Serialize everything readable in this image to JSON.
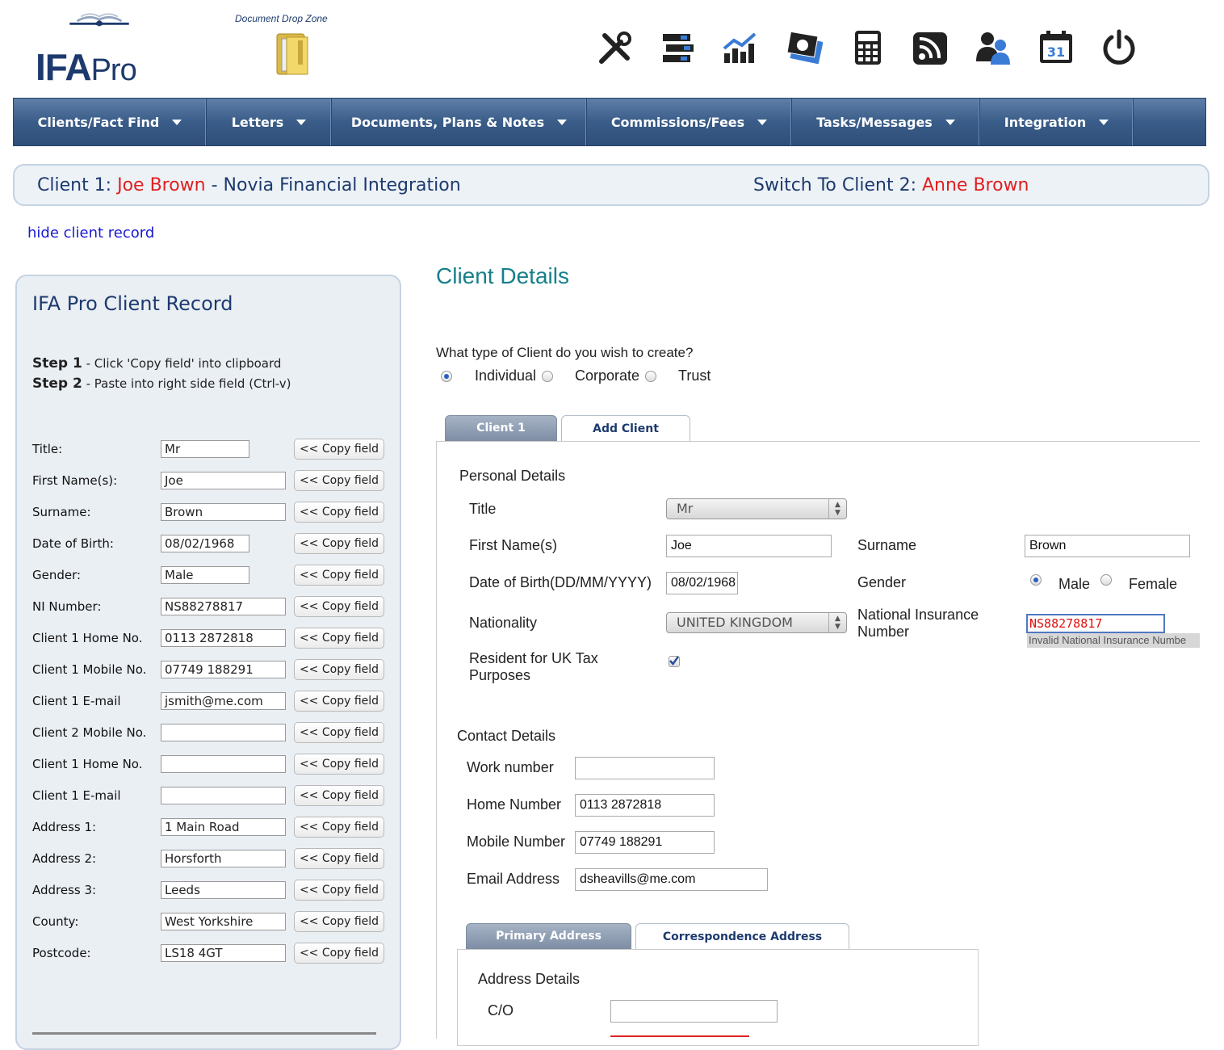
{
  "header": {
    "logo": "IFA Pro",
    "drop_zone_label": "Document Drop Zone",
    "toolbar_icons": [
      "tools-icon",
      "servers-icon",
      "growth-chart-icon",
      "money-icon",
      "calculator-icon",
      "rss-icon",
      "users-icon",
      "calendar-icon",
      "power-icon"
    ],
    "calendar_day": "31"
  },
  "nav": {
    "items": [
      {
        "label": "Clients/Fact Find"
      },
      {
        "label": "Letters"
      },
      {
        "label": "Documents, Plans & Notes"
      },
      {
        "label": "Commissions/Fees"
      },
      {
        "label": "Tasks/Messages"
      },
      {
        "label": "Integration"
      }
    ]
  },
  "client_bar": {
    "client1_prefix": "Client 1:",
    "client1_name": "Joe Brown",
    "client1_suffix": "- Novia Financial Integration",
    "switch_prefix": "Switch To Client 2:",
    "client2_name": "Anne Brown"
  },
  "hide_link": "hide client record",
  "left_panel": {
    "title": "IFA Pro Client Record",
    "step1_label": "Step 1",
    "step1_text": "- Click 'Copy field' into clipboard",
    "step2_label": "Step 2",
    "step2_text": "- Paste into right side field (Ctrl-v)",
    "copy_label": "<< Copy field",
    "rows": [
      {
        "label": "Title:",
        "value": "Mr"
      },
      {
        "label": "First Name(s):",
        "value": "Joe"
      },
      {
        "label": "Surname:",
        "value": "Brown"
      },
      {
        "label": "Date of Birth:",
        "value": "08/02/1968"
      },
      {
        "label": "Gender:",
        "value": "Male"
      },
      {
        "label": "NI Number:",
        "value": "NS88278817"
      },
      {
        "label": "Client 1 Home No.",
        "value": "0113 2872818"
      },
      {
        "label": "Client 1 Mobile No.",
        "value": "07749 188291"
      },
      {
        "label": "Client 1 E-mail",
        "value": "jsmith@me.com"
      },
      {
        "label": "Client 2 Mobile No.",
        "value": ""
      },
      {
        "label": "Client 1 Home No.",
        "value": ""
      },
      {
        "label": "Client 1 E-mail",
        "value": ""
      },
      {
        "label": "Address 1:",
        "value": "1 Main Road"
      },
      {
        "label": "Address 2:",
        "value": "Horsforth"
      },
      {
        "label": "Address 3:",
        "value": "Leeds"
      },
      {
        "label": "County:",
        "value": "West Yorkshire"
      },
      {
        "label": "Postcode:",
        "value": "LS18 4GT"
      }
    ]
  },
  "client_details": {
    "title": "Client Details",
    "type_question": "What type of Client do you wish to create?",
    "type_options": [
      "Individual",
      "Corporate",
      "Trust"
    ],
    "type_selected": "Individual",
    "tabs": [
      "Client 1",
      "Add Client"
    ],
    "personal_heading": "Personal Details",
    "title_label": "Title",
    "title_value": "Mr",
    "first_name_label": "First Name(s)",
    "first_name_value": "Joe",
    "surname_label": "Surname",
    "surname_value": "Brown",
    "dob_label": "Date of Birth(DD/MM/YYYY)",
    "dob_value": "08/02/1968",
    "gender_label": "Gender",
    "gender_options": [
      "Male",
      "Female"
    ],
    "gender_selected": "Male",
    "nationality_label": "Nationality",
    "nationality_value": "UNITED KINGDOM",
    "ni_label_line1": "National Insurance",
    "ni_label_line2": "Number",
    "ni_value": "NS88278817",
    "ni_error": "Invalid National Insurance Numbe",
    "resident_label_line1": "Resident for UK Tax",
    "resident_label_line2": "Purposes",
    "resident_checked": true,
    "contact_heading": "Contact Details",
    "work_label": "Work number",
    "work_value": "",
    "home_label": "Home Number",
    "home_value": "0113 2872818",
    "mobile_label": "Mobile Number",
    "mobile_value": "07749 188291",
    "email_label": "Email Address",
    "email_value": "dsheavills@me.com",
    "address_tabs": [
      "Primary Address",
      "Correspondence Address"
    ],
    "address_heading": "Address Details",
    "co_label": "C/O",
    "co_value": ""
  }
}
